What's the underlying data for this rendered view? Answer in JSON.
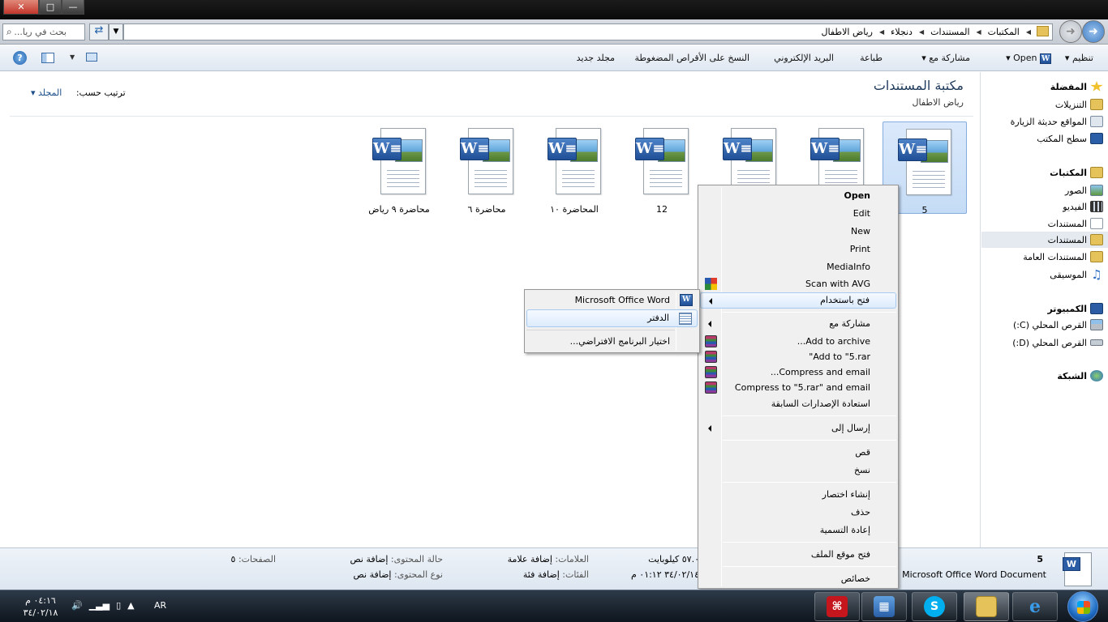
{
  "window": {
    "close": "✕",
    "maximize": "□",
    "minimize": "—"
  },
  "search": {
    "placeholder": "بحث في ريا..."
  },
  "breadcrumb": [
    "المكتبات",
    "المستندات",
    "دنجلاء",
    "رياض الاطفال"
  ],
  "toolbar": {
    "organize": "تنظيم",
    "open": "Open",
    "share": "مشاركة مع",
    "print": "طباعة",
    "email": "البريد الإلكتروني",
    "burn": "النسخ على الأقراص المضغوطة",
    "new_folder": "مجلد جديد"
  },
  "sidebar": {
    "favorites": {
      "label": "المفضلة",
      "items": [
        "التنزيلات",
        "المواقع حديثة الزيارة",
        "سطح المكتب"
      ]
    },
    "libraries": {
      "label": "المكتبات",
      "items": [
        "الصور",
        "الفيديو",
        "المستندات",
        "المستندات",
        "المستندات العامة",
        "الموسيقى"
      ]
    },
    "computer": {
      "label": "الكمبيوتر",
      "items": [
        "القرص المحلي (C:)",
        "القرص المحلي (D:)"
      ]
    },
    "network": {
      "label": "الشبكة"
    }
  },
  "content": {
    "library_title": "مكتبة المستندات",
    "library_subtitle": "رياض الاطفال",
    "arrange_label": "ترتيب حسب:",
    "arrange_value": "المجلد"
  },
  "files": [
    {
      "name": "5",
      "selected": true
    },
    {
      "name": "",
      "selected": false
    },
    {
      "name": "",
      "selected": false
    },
    {
      "name": "12",
      "selected": false
    },
    {
      "name": "المحاضرة ١٠",
      "selected": false
    },
    {
      "name": "محاضرة ٦",
      "selected": false
    },
    {
      "name": "محاضرة ٩ رياض",
      "selected": false
    }
  ],
  "context_menu": {
    "open": "Open",
    "edit": "Edit",
    "new": "New",
    "print": "Print",
    "mediainfo": "MediaInfo",
    "scan": "Scan with AVG",
    "open_with": "فتح باستخدام",
    "share_with": "مشاركة مع",
    "add_archive": "Add to archive...",
    "add_rar": "Add to \"5.rar\"",
    "compress_email": "Compress and email...",
    "compress_rar_email": "Compress to \"5.rar\" and email",
    "restore": "استعادة الإصدارات السابقة",
    "send_to": "إرسال إلى",
    "cut": "قص",
    "copy": "نسخ",
    "shortcut": "إنشاء اختصار",
    "delete": "حذف",
    "rename": "إعادة التسمية",
    "open_location": "فتح موقع الملف",
    "properties": "خصائص"
  },
  "submenu": {
    "word": "Microsoft Office Word",
    "wordpad": "الدفتر",
    "choose_default": "اختيار البرنامج الافتراضي..."
  },
  "details": {
    "name": "5",
    "type": "Microsoft Office Word Document",
    "size": "٥٧.٠ كيلوبايت",
    "date": "٣٤/٠٢/١٤ ٠١:١٢ م",
    "tags_label": "العلامات:",
    "tags_value": "إضافة علامة",
    "categories_label": "الفئات:",
    "categories_value": "إضافة فئة",
    "content_status_label": "حالة المحتوى:",
    "content_status_value": "إضافة نص",
    "content_type_label": "نوع المحتوى:",
    "content_type_value": "إضافة نص",
    "pages_label": "الصفحات:",
    "pages_value": "٥"
  },
  "taskbar": {
    "time": "٠٤:١٦ م",
    "date": "٣٤/٠٢/١٨",
    "language": "AR"
  }
}
